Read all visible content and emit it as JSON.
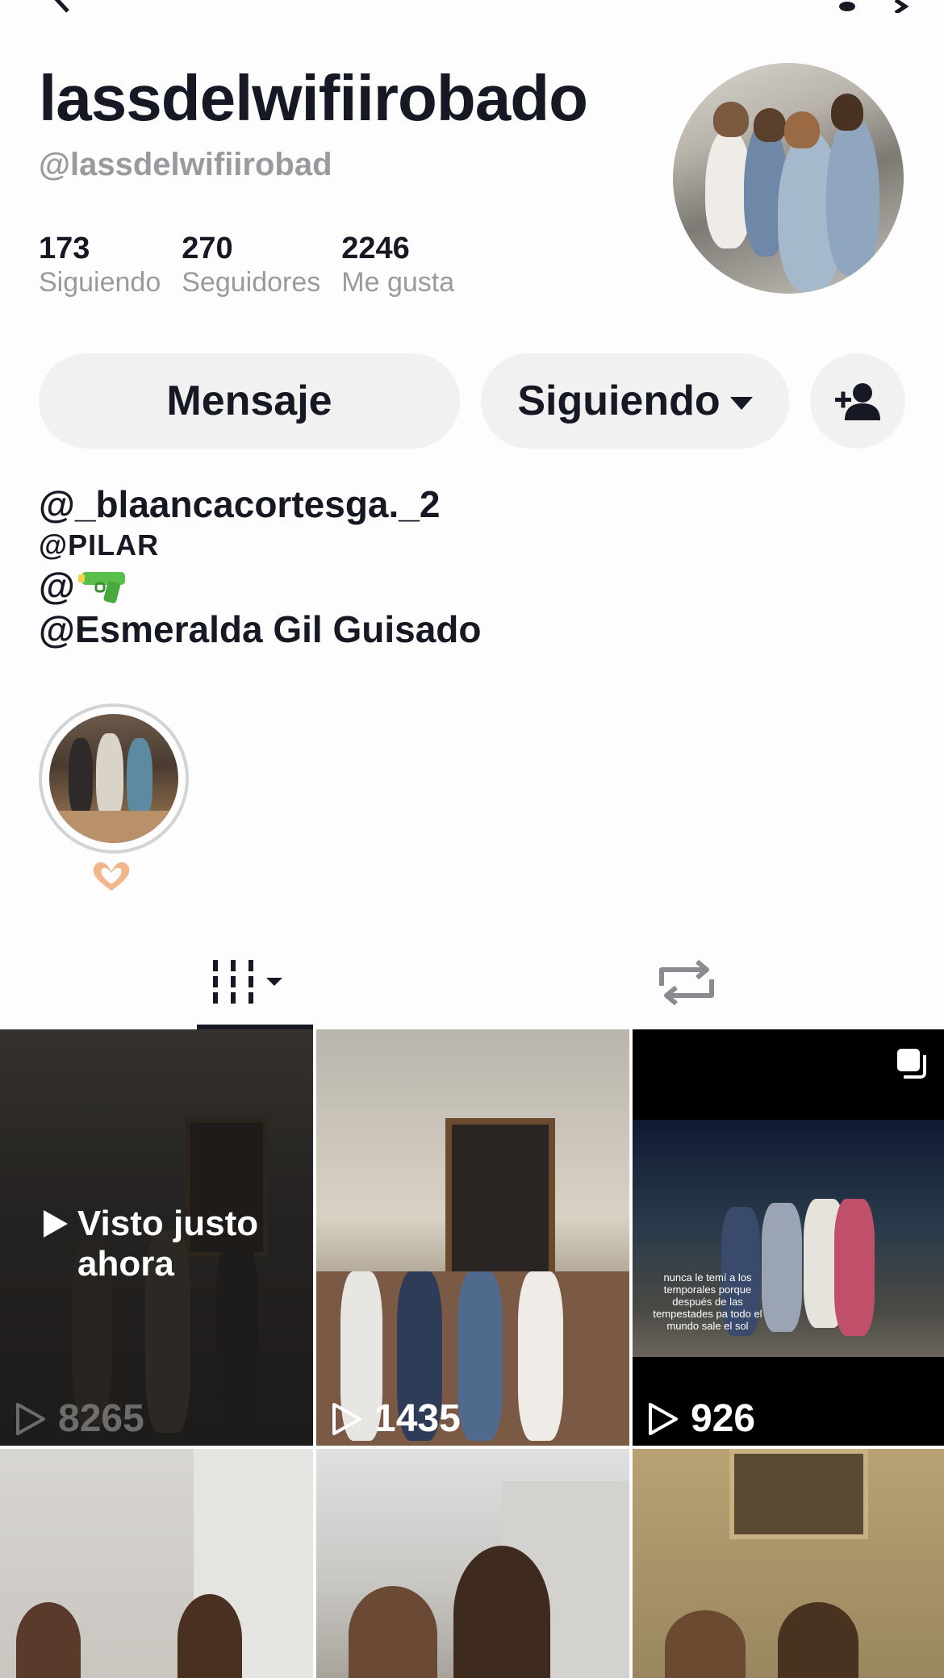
{
  "profile": {
    "display_name": "lassdelwifiirobado",
    "username": "@lassdelwifiirobad",
    "stats": [
      {
        "value": "173",
        "label": "Siguiendo"
      },
      {
        "value": "270",
        "label": "Seguidores"
      },
      {
        "value": "2246",
        "label": "Me gusta"
      }
    ]
  },
  "actions": {
    "message_label": "Mensaje",
    "following_label": "Siguiendo"
  },
  "bio": {
    "line1": "@_blaancacortesga._2",
    "line2": "@PILAR",
    "line3_prefix": "@",
    "line4": "@Esmeralda Gil Guisado"
  },
  "tabs": {
    "videos_icon": "grid-columns-icon",
    "reposts_icon": "repost-icon"
  },
  "videos": [
    {
      "views": "8265",
      "status": "Visto justo ahora"
    },
    {
      "views": "1435"
    },
    {
      "views": "926",
      "caption": "nunca le temí a los temporales porque después de las tempestades pa todo el mundo sale el sol"
    }
  ],
  "colors": {
    "text": "#161823",
    "secondary": "#9a9a9e",
    "button_bg": "#f1f1f2"
  }
}
